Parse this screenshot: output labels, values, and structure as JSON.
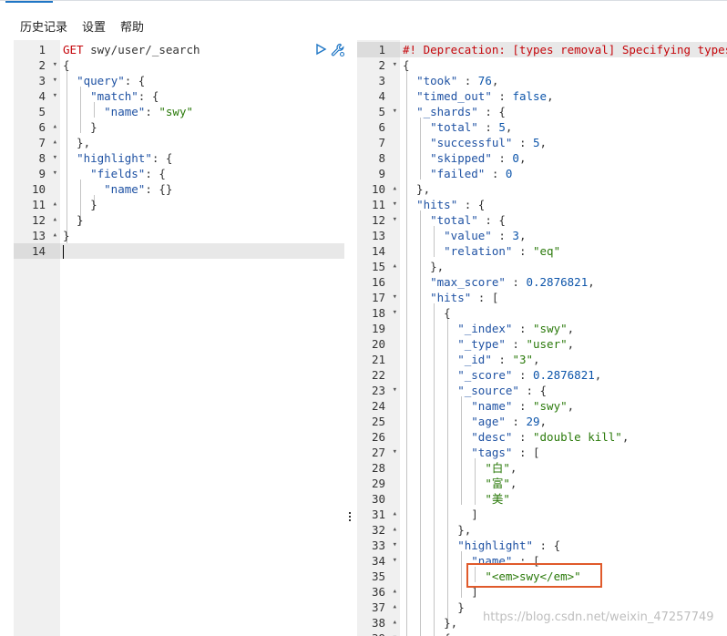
{
  "menu": {
    "items": [
      "历史记录",
      "设置",
      "帮助"
    ]
  },
  "request": {
    "lines": [
      {
        "num": "1",
        "fold": "",
        "tokens": [
          [
            "method",
            "GET"
          ],
          [
            "url",
            " swy/user/_search"
          ]
        ]
      },
      {
        "num": "2",
        "fold": "▾",
        "tokens": [
          [
            "punc",
            "{"
          ]
        ]
      },
      {
        "num": "3",
        "fold": "▾",
        "tokens": [
          [
            "punc",
            "  "
          ],
          [
            "key",
            "\"query\""
          ],
          [
            "punc",
            ": {"
          ]
        ]
      },
      {
        "num": "4",
        "fold": "▾",
        "tokens": [
          [
            "punc",
            "    "
          ],
          [
            "key",
            "\"match\""
          ],
          [
            "punc",
            ": {"
          ]
        ]
      },
      {
        "num": "5",
        "fold": "",
        "tokens": [
          [
            "punc",
            "      "
          ],
          [
            "key",
            "\"name\""
          ],
          [
            "punc",
            ": "
          ],
          [
            "str",
            "\"swy\""
          ]
        ]
      },
      {
        "num": "6",
        "fold": "▴",
        "tokens": [
          [
            "punc",
            "    }"
          ]
        ]
      },
      {
        "num": "7",
        "fold": "▴",
        "tokens": [
          [
            "punc",
            "  },"
          ]
        ]
      },
      {
        "num": "8",
        "fold": "▾",
        "tokens": [
          [
            "punc",
            "  "
          ],
          [
            "key",
            "\"highlight\""
          ],
          [
            "punc",
            ": {"
          ]
        ]
      },
      {
        "num": "9",
        "fold": "▾",
        "tokens": [
          [
            "punc",
            "    "
          ],
          [
            "key",
            "\"fields\""
          ],
          [
            "punc",
            ": {"
          ]
        ]
      },
      {
        "num": "10",
        "fold": "",
        "tokens": [
          [
            "punc",
            "      "
          ],
          [
            "key",
            "\"name\""
          ],
          [
            "punc",
            ": {}"
          ]
        ]
      },
      {
        "num": "11",
        "fold": "▴",
        "tokens": [
          [
            "punc",
            "    }"
          ]
        ]
      },
      {
        "num": "12",
        "fold": "▴",
        "tokens": [
          [
            "punc",
            "  }"
          ]
        ]
      },
      {
        "num": "13",
        "fold": "▴",
        "tokens": [
          [
            "punc",
            "}"
          ]
        ]
      },
      {
        "num": "14",
        "fold": "",
        "tokens": [],
        "active": true
      }
    ]
  },
  "response": {
    "lines": [
      {
        "num": "1",
        "fold": "",
        "tokens": [
          [
            "comment",
            "#! Deprecation: [types removal] Specifying types in search requests is deprecated."
          ]
        ],
        "active": true
      },
      {
        "num": "2",
        "fold": "▾",
        "tokens": [
          [
            "punc",
            "{"
          ]
        ]
      },
      {
        "num": "3",
        "fold": "",
        "tokens": [
          [
            "punc",
            "  "
          ],
          [
            "key",
            "\"took\""
          ],
          [
            "punc",
            " : "
          ],
          [
            "num",
            "76"
          ],
          [
            "punc",
            ","
          ]
        ]
      },
      {
        "num": "4",
        "fold": "",
        "tokens": [
          [
            "punc",
            "  "
          ],
          [
            "key",
            "\"timed_out\""
          ],
          [
            "punc",
            " : "
          ],
          [
            "bool",
            "false"
          ],
          [
            "punc",
            ","
          ]
        ]
      },
      {
        "num": "5",
        "fold": "▾",
        "tokens": [
          [
            "punc",
            "  "
          ],
          [
            "key",
            "\"_shards\""
          ],
          [
            "punc",
            " : {"
          ]
        ]
      },
      {
        "num": "6",
        "fold": "",
        "tokens": [
          [
            "punc",
            "    "
          ],
          [
            "key",
            "\"total\""
          ],
          [
            "punc",
            " : "
          ],
          [
            "num",
            "5"
          ],
          [
            "punc",
            ","
          ]
        ]
      },
      {
        "num": "7",
        "fold": "",
        "tokens": [
          [
            "punc",
            "    "
          ],
          [
            "key",
            "\"successful\""
          ],
          [
            "punc",
            " : "
          ],
          [
            "num",
            "5"
          ],
          [
            "punc",
            ","
          ]
        ]
      },
      {
        "num": "8",
        "fold": "",
        "tokens": [
          [
            "punc",
            "    "
          ],
          [
            "key",
            "\"skipped\""
          ],
          [
            "punc",
            " : "
          ],
          [
            "num",
            "0"
          ],
          [
            "punc",
            ","
          ]
        ]
      },
      {
        "num": "9",
        "fold": "",
        "tokens": [
          [
            "punc",
            "    "
          ],
          [
            "key",
            "\"failed\""
          ],
          [
            "punc",
            " : "
          ],
          [
            "num",
            "0"
          ]
        ]
      },
      {
        "num": "10",
        "fold": "▴",
        "tokens": [
          [
            "punc",
            "  },"
          ]
        ]
      },
      {
        "num": "11",
        "fold": "▾",
        "tokens": [
          [
            "punc",
            "  "
          ],
          [
            "key",
            "\"hits\""
          ],
          [
            "punc",
            " : {"
          ]
        ]
      },
      {
        "num": "12",
        "fold": "▾",
        "tokens": [
          [
            "punc",
            "    "
          ],
          [
            "key",
            "\"total\""
          ],
          [
            "punc",
            " : {"
          ]
        ]
      },
      {
        "num": "13",
        "fold": "",
        "tokens": [
          [
            "punc",
            "      "
          ],
          [
            "key",
            "\"value\""
          ],
          [
            "punc",
            " : "
          ],
          [
            "num",
            "3"
          ],
          [
            "punc",
            ","
          ]
        ]
      },
      {
        "num": "14",
        "fold": "",
        "tokens": [
          [
            "punc",
            "      "
          ],
          [
            "key",
            "\"relation\""
          ],
          [
            "punc",
            " : "
          ],
          [
            "str",
            "\"eq\""
          ]
        ]
      },
      {
        "num": "15",
        "fold": "▴",
        "tokens": [
          [
            "punc",
            "    },"
          ]
        ]
      },
      {
        "num": "16",
        "fold": "",
        "tokens": [
          [
            "punc",
            "    "
          ],
          [
            "key",
            "\"max_score\""
          ],
          [
            "punc",
            " : "
          ],
          [
            "num",
            "0.2876821"
          ],
          [
            "punc",
            ","
          ]
        ]
      },
      {
        "num": "17",
        "fold": "▾",
        "tokens": [
          [
            "punc",
            "    "
          ],
          [
            "key",
            "\"hits\""
          ],
          [
            "punc",
            " : ["
          ]
        ]
      },
      {
        "num": "18",
        "fold": "▾",
        "tokens": [
          [
            "punc",
            "      {"
          ]
        ]
      },
      {
        "num": "19",
        "fold": "",
        "tokens": [
          [
            "punc",
            "        "
          ],
          [
            "key",
            "\"_index\""
          ],
          [
            "punc",
            " : "
          ],
          [
            "str",
            "\"swy\""
          ],
          [
            "punc",
            ","
          ]
        ]
      },
      {
        "num": "20",
        "fold": "",
        "tokens": [
          [
            "punc",
            "        "
          ],
          [
            "key",
            "\"_type\""
          ],
          [
            "punc",
            " : "
          ],
          [
            "str",
            "\"user\""
          ],
          [
            "punc",
            ","
          ]
        ]
      },
      {
        "num": "21",
        "fold": "",
        "tokens": [
          [
            "punc",
            "        "
          ],
          [
            "key",
            "\"_id\""
          ],
          [
            "punc",
            " : "
          ],
          [
            "str",
            "\"3\""
          ],
          [
            "punc",
            ","
          ]
        ]
      },
      {
        "num": "22",
        "fold": "",
        "tokens": [
          [
            "punc",
            "        "
          ],
          [
            "key",
            "\"_score\""
          ],
          [
            "punc",
            " : "
          ],
          [
            "num",
            "0.2876821"
          ],
          [
            "punc",
            ","
          ]
        ]
      },
      {
        "num": "23",
        "fold": "▾",
        "tokens": [
          [
            "punc",
            "        "
          ],
          [
            "key",
            "\"_source\""
          ],
          [
            "punc",
            " : {"
          ]
        ]
      },
      {
        "num": "24",
        "fold": "",
        "tokens": [
          [
            "punc",
            "          "
          ],
          [
            "key",
            "\"name\""
          ],
          [
            "punc",
            " : "
          ],
          [
            "str",
            "\"swy\""
          ],
          [
            "punc",
            ","
          ]
        ]
      },
      {
        "num": "25",
        "fold": "",
        "tokens": [
          [
            "punc",
            "          "
          ],
          [
            "key",
            "\"age\""
          ],
          [
            "punc",
            " : "
          ],
          [
            "num",
            "29"
          ],
          [
            "punc",
            ","
          ]
        ]
      },
      {
        "num": "26",
        "fold": "",
        "tokens": [
          [
            "punc",
            "          "
          ],
          [
            "key",
            "\"desc\""
          ],
          [
            "punc",
            " : "
          ],
          [
            "str",
            "\"double kill\""
          ],
          [
            "punc",
            ","
          ]
        ]
      },
      {
        "num": "27",
        "fold": "▾",
        "tokens": [
          [
            "punc",
            "          "
          ],
          [
            "key",
            "\"tags\""
          ],
          [
            "punc",
            " : ["
          ]
        ]
      },
      {
        "num": "28",
        "fold": "",
        "tokens": [
          [
            "punc",
            "            "
          ],
          [
            "str",
            "\"白\""
          ],
          [
            "punc",
            ","
          ]
        ]
      },
      {
        "num": "29",
        "fold": "",
        "tokens": [
          [
            "punc",
            "            "
          ],
          [
            "str",
            "\"富\""
          ],
          [
            "punc",
            ","
          ]
        ]
      },
      {
        "num": "30",
        "fold": "",
        "tokens": [
          [
            "punc",
            "            "
          ],
          [
            "str",
            "\"美\""
          ]
        ]
      },
      {
        "num": "31",
        "fold": "▴",
        "tokens": [
          [
            "punc",
            "          ]"
          ]
        ]
      },
      {
        "num": "32",
        "fold": "▴",
        "tokens": [
          [
            "punc",
            "        },"
          ]
        ]
      },
      {
        "num": "33",
        "fold": "▾",
        "tokens": [
          [
            "punc",
            "        "
          ],
          [
            "key",
            "\"highlight\""
          ],
          [
            "punc",
            " : {"
          ]
        ]
      },
      {
        "num": "34",
        "fold": "▾",
        "tokens": [
          [
            "punc",
            "          "
          ],
          [
            "key",
            "\"name\""
          ],
          [
            "punc",
            " : ["
          ]
        ]
      },
      {
        "num": "35",
        "fold": "",
        "tokens": [
          [
            "punc",
            "            "
          ],
          [
            "str",
            "\"<em>swy</em>\""
          ]
        ]
      },
      {
        "num": "36",
        "fold": "▴",
        "tokens": [
          [
            "punc",
            "          ]"
          ]
        ]
      },
      {
        "num": "37",
        "fold": "▴",
        "tokens": [
          [
            "punc",
            "        }"
          ]
        ]
      },
      {
        "num": "38",
        "fold": "▴",
        "tokens": [
          [
            "punc",
            "      },"
          ]
        ]
      },
      {
        "num": "39",
        "fold": "▾",
        "tokens": [
          [
            "punc",
            "      {"
          ]
        ]
      }
    ]
  },
  "watermark": "https://blog.csdn.net/weixin_47257749",
  "icons": {
    "run": "play-icon",
    "settings": "wrench-icon",
    "splitter": "drag-handle-icon"
  }
}
